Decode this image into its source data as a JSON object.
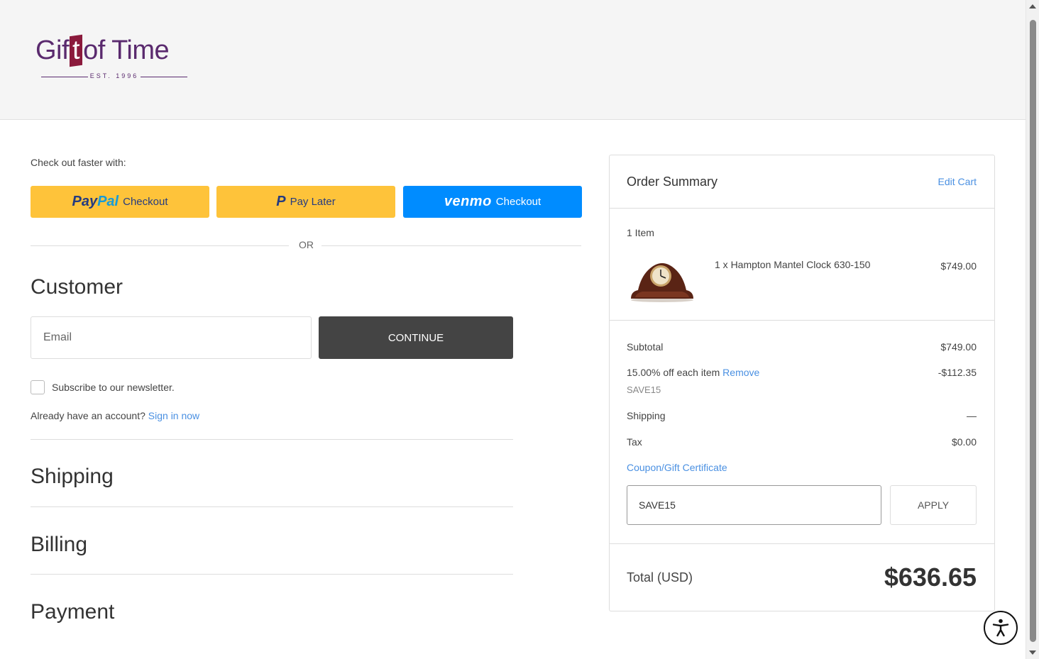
{
  "header": {
    "logo_text_a": "Gif",
    "logo_text_t": "t",
    "logo_text_b": "of Time",
    "logo_est": "EST. 1996"
  },
  "checkout": {
    "faster_label": "Check out faster with:",
    "paypal": {
      "brand_a": "Pay",
      "brand_b": "Pal",
      "label": "Checkout"
    },
    "paylater": {
      "mark": "P",
      "label": "Pay Later"
    },
    "venmo": {
      "brand": "venmo",
      "label": "Checkout"
    },
    "or_label": "OR"
  },
  "customer": {
    "title": "Customer",
    "email_placeholder": "Email",
    "continue_label": "CONTINUE",
    "newsletter_label": "Subscribe to our newsletter.",
    "account_question": "Already have an account?",
    "sign_in_label": "Sign in now"
  },
  "sections": {
    "shipping": "Shipping",
    "billing": "Billing",
    "payment": "Payment"
  },
  "summary": {
    "title": "Order Summary",
    "edit_cart": "Edit Cart",
    "item_count": "1 Item",
    "item": {
      "name": "1 x Hampton Mantel Clock 630-150",
      "price": "$749.00"
    },
    "subtotal_label": "Subtotal",
    "subtotal_value": "$749.00",
    "discount_label": "15.00% off each item",
    "discount_remove": "Remove",
    "discount_value": "-$112.35",
    "discount_code": "SAVE15",
    "shipping_label": "Shipping",
    "shipping_value": "—",
    "tax_label": "Tax",
    "tax_value": "$0.00",
    "coupon_link": "Coupon/Gift Certificate",
    "coupon_value": "SAVE15",
    "apply_label": "APPLY",
    "total_label": "Total (USD)",
    "total_value": "$636.65"
  },
  "colors": {
    "paypal_yellow": "#fec33a",
    "venmo_blue": "#008cff",
    "link_blue": "#4a90e2",
    "dark_button": "#444444"
  },
  "icons": {
    "accessibility": "accessibility-icon"
  }
}
